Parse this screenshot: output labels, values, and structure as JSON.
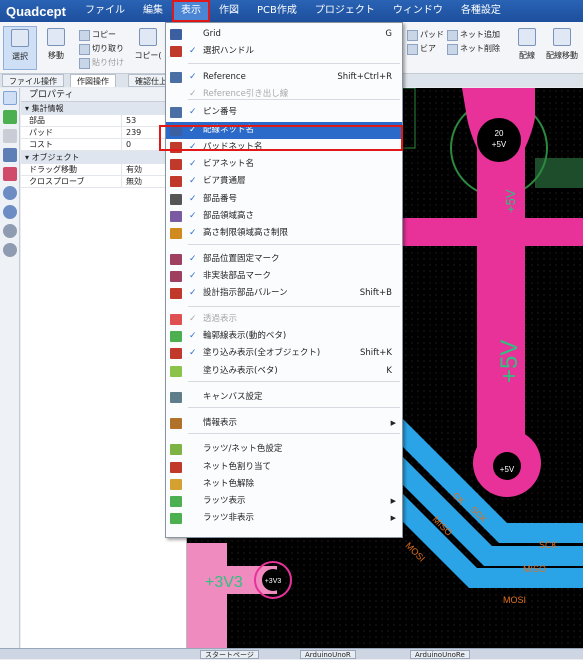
{
  "app": {
    "logo": "Quadcept"
  },
  "menubar": [
    {
      "label": "ファイル",
      "active": false
    },
    {
      "label": "編集",
      "active": false
    },
    {
      "label": "表示",
      "active": true
    },
    {
      "label": "作図",
      "active": false
    },
    {
      "label": "PCB作成",
      "active": false
    },
    {
      "label": "プロジェクト",
      "active": false
    },
    {
      "label": "ウィンドウ",
      "active": false
    },
    {
      "label": "各種設定",
      "active": false
    }
  ],
  "ribbon": {
    "select": "選択",
    "move": "移動",
    "copy": "コピー",
    "cut": "切り取り",
    "paste": "貼り付け",
    "copy2": "コピー(",
    "pad": "パッド",
    "via": "ビア",
    "net_add": "ネット追加",
    "net_del": "ネット削除",
    "route": "配線",
    "route_move": "配線移動"
  },
  "tabs": [
    "ファイル操作",
    "作図操作",
    "確認仕上"
  ],
  "properties": {
    "title": "プロパティ",
    "group1": "集計情報",
    "rows1": [
      {
        "key": "部品",
        "value": "53"
      },
      {
        "key": "パッド",
        "value": "239"
      },
      {
        "key": "コスト",
        "value": "0"
      }
    ],
    "group2": "オブジェクト",
    "rows2": [
      {
        "key": "ドラッグ移動",
        "value": "有効"
      },
      {
        "key": "クロスプローブ",
        "value": "無効"
      }
    ]
  },
  "canvas_labels": {
    "pad_top": "20",
    "pad_top_net": "+5V",
    "trace_v1": "+5V",
    "trace_v2": "+5V",
    "pad_bottom_net": "+5V",
    "bus1": "SCK",
    "bus2": "MISO",
    "bus3": "MOSI",
    "bus_label_sck": "SCK",
    "bus_label_miso": "MISO",
    "bus_label_mosi": "MOSI",
    "ck": "CK",
    "v33": "+3V3",
    "v33_pad": "+3V3"
  },
  "statusbar": [
    "スタートページ",
    "ArduinoUnoR",
    "ArduinoUnoRe"
  ],
  "dropdown": {
    "items": [
      {
        "label": "Grid",
        "shortcut": "G",
        "checked": false,
        "disabled": false,
        "icon": "grid-icon",
        "color": "#3b5fa0"
      },
      {
        "label": "選択ハンドル",
        "shortcut": "",
        "checked": true,
        "disabled": false,
        "icon": "handle-icon",
        "color": "#c0392b"
      },
      {
        "label": "Reference",
        "shortcut": "Shift+Ctrl+R",
        "checked": true,
        "disabled": false,
        "icon": "reference-icon",
        "color": "#4a6fa5"
      },
      {
        "label": "Reference引き出し線",
        "shortcut": "",
        "checked": true,
        "disabled": true,
        "icon": "",
        "color": ""
      },
      {
        "label": "ピン番号",
        "shortcut": "",
        "checked": true,
        "disabled": false,
        "icon": "pin-number-icon",
        "color": "#4a6fa5"
      },
      {
        "label": "配線ネット名",
        "shortcut": "",
        "checked": true,
        "disabled": false,
        "icon": "wire-net-icon",
        "color": "#3b5fa0"
      },
      {
        "label": "パッドネット名",
        "shortcut": "",
        "checked": true,
        "disabled": false,
        "icon": "pad-net-icon",
        "color": "#c0392b"
      },
      {
        "label": "ビアネット名",
        "shortcut": "",
        "checked": true,
        "disabled": false,
        "icon": "via-net-icon",
        "color": "#c0392b"
      },
      {
        "label": "ビア貫通層",
        "shortcut": "",
        "checked": true,
        "disabled": false,
        "icon": "via-layer-icon",
        "color": "#c0392b"
      },
      {
        "label": "部品番号",
        "shortcut": "",
        "checked": true,
        "disabled": false,
        "icon": "part-number-icon",
        "color": "#555"
      },
      {
        "label": "部品領域高さ",
        "shortcut": "",
        "checked": true,
        "disabled": false,
        "icon": "part-area-icon",
        "color": "#7a5aa0"
      },
      {
        "label": "高さ制限領域高さ制限",
        "shortcut": "",
        "checked": true,
        "disabled": false,
        "icon": "height-limit-icon",
        "color": "#d08a20"
      },
      {
        "label": "部品位置固定マーク",
        "shortcut": "",
        "checked": true,
        "disabled": false,
        "icon": "fix-mark-icon",
        "color": "#a04060"
      },
      {
        "label": "非実装部品マーク",
        "shortcut": "",
        "checked": true,
        "disabled": false,
        "icon": "no-mount-icon",
        "color": "#a04060"
      },
      {
        "label": "設計指示部品バルーン",
        "shortcut": "Shift+B",
        "checked": true,
        "disabled": false,
        "icon": "balloon-icon",
        "color": "#c0392b"
      },
      {
        "label": "透過表示",
        "shortcut": "",
        "checked": true,
        "disabled": true,
        "icon": "transparent-icon",
        "color": "#e05050"
      },
      {
        "label": "輪郭線表示(動的ベタ)",
        "shortcut": "",
        "checked": true,
        "disabled": false,
        "icon": "outline-icon",
        "color": "#4caf50"
      },
      {
        "label": "塗り込み表示(全オブジェクト)",
        "shortcut": "Shift+K",
        "checked": true,
        "disabled": false,
        "icon": "fill-all-icon",
        "color": "#c0392b"
      },
      {
        "label": "塗り込み表示(ベタ)",
        "shortcut": "K",
        "checked": false,
        "disabled": false,
        "icon": "fill-icon",
        "color": "#8bc34a"
      },
      {
        "label": "キャンバス設定",
        "shortcut": "",
        "checked": false,
        "disabled": false,
        "icon": "canvas-icon",
        "color": "#607d8b"
      },
      {
        "label": "情報表示",
        "shortcut": "",
        "checked": false,
        "disabled": false,
        "icon": "info-icon",
        "color": "#b0722a",
        "submenu": true
      },
      {
        "label": "ラッツ/ネット色設定",
        "shortcut": "",
        "checked": false,
        "disabled": false,
        "icon": "rats-color-icon",
        "color": "#7cb342"
      },
      {
        "label": "ネット色割り当て",
        "shortcut": "",
        "checked": false,
        "disabled": false,
        "icon": "net-color-icon",
        "color": "#c0392b"
      },
      {
        "label": "ネット色解除",
        "shortcut": "",
        "checked": false,
        "disabled": false,
        "icon": "net-clear-icon",
        "color": "#d4a030"
      },
      {
        "label": "ラッツ表示",
        "shortcut": "",
        "checked": false,
        "disabled": false,
        "icon": "rats-show-icon",
        "color": "#4caf50",
        "submenu": true
      },
      {
        "label": "ラッツ非表示",
        "shortcut": "",
        "checked": false,
        "disabled": false,
        "icon": "rats-hide-icon",
        "color": "#4caf50",
        "submenu": true
      }
    ]
  }
}
